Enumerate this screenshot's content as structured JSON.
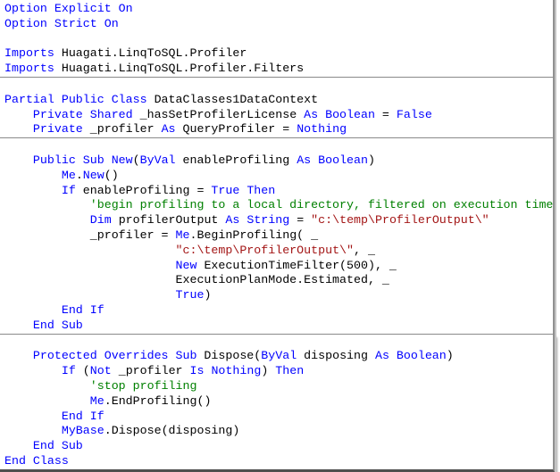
{
  "colors": {
    "keyword": "#0000ff",
    "text": "#000000",
    "comment": "#008000",
    "string": "#a31515",
    "background": "#ffffff",
    "separator_line": "#8a8a8a",
    "right_border": "#909090",
    "right_border_shadow": "#c4c4c4",
    "bottom_border": "#4f4f4f",
    "drop_shadow": "#a8a8a8"
  },
  "code": {
    "slices": [
      {
        "lines": [
          {
            "segments": [
              {
                "text": "Option Explicit On",
                "type": "keyword"
              }
            ]
          },
          {
            "segments": [
              {
                "text": "Option Strict On",
                "type": "keyword"
              }
            ]
          },
          {
            "segments": []
          },
          {
            "segments": [
              {
                "text": "Imports",
                "type": "keyword"
              },
              {
                "text": " Huagati.LinqToSQL.Profiler",
                "type": "text"
              }
            ]
          },
          {
            "segments": [
              {
                "text": "Imports",
                "type": "keyword"
              },
              {
                "text": " Huagati.LinqToSQL.Profiler.Filters",
                "type": "text"
              }
            ]
          }
        ]
      },
      {
        "lines": [
          {
            "segments": []
          },
          {
            "segments": [
              {
                "text": "Partial Public Class",
                "type": "keyword"
              },
              {
                "text": " DataClasses1DataContext",
                "type": "text"
              }
            ]
          },
          {
            "segments": [
              {
                "text": "    ",
                "type": "text"
              },
              {
                "text": "Private Shared",
                "type": "keyword"
              },
              {
                "text": " _hasSetProfilerLicense ",
                "type": "text"
              },
              {
                "text": "As Boolean",
                "type": "keyword"
              },
              {
                "text": " = ",
                "type": "text"
              },
              {
                "text": "False",
                "type": "keyword"
              }
            ]
          },
          {
            "segments": [
              {
                "text": "    ",
                "type": "text"
              },
              {
                "text": "Private",
                "type": "keyword"
              },
              {
                "text": " _profiler ",
                "type": "text"
              },
              {
                "text": "As",
                "type": "keyword"
              },
              {
                "text": " QueryProfiler = ",
                "type": "text"
              },
              {
                "text": "Nothing",
                "type": "keyword"
              }
            ]
          }
        ]
      },
      {
        "lines": [
          {
            "segments": []
          },
          {
            "segments": [
              {
                "text": "    ",
                "type": "text"
              },
              {
                "text": "Public Sub New",
                "type": "keyword"
              },
              {
                "text": "(",
                "type": "text"
              },
              {
                "text": "ByVal",
                "type": "keyword"
              },
              {
                "text": " enableProfiling ",
                "type": "text"
              },
              {
                "text": "As Boolean",
                "type": "keyword"
              },
              {
                "text": ")",
                "type": "text"
              }
            ]
          },
          {
            "segments": [
              {
                "text": "        ",
                "type": "text"
              },
              {
                "text": "Me",
                "type": "keyword"
              },
              {
                "text": ".",
                "type": "text"
              },
              {
                "text": "New",
                "type": "keyword"
              },
              {
                "text": "()",
                "type": "text"
              }
            ]
          },
          {
            "segments": [
              {
                "text": "        ",
                "type": "text"
              },
              {
                "text": "If",
                "type": "keyword"
              },
              {
                "text": " enableProfiling = ",
                "type": "text"
              },
              {
                "text": "True Then",
                "type": "keyword"
              }
            ]
          },
          {
            "segments": [
              {
                "text": "            'begin profiling to a local directory, filtered on execution time",
                "type": "comment"
              }
            ]
          },
          {
            "segments": [
              {
                "text": "            ",
                "type": "text"
              },
              {
                "text": "Dim",
                "type": "keyword"
              },
              {
                "text": " profilerOutput ",
                "type": "text"
              },
              {
                "text": "As String",
                "type": "keyword"
              },
              {
                "text": " = ",
                "type": "text"
              },
              {
                "text": "\"c:\\temp\\ProfilerOutput\\\"",
                "type": "string"
              }
            ]
          },
          {
            "segments": [
              {
                "text": "            _profiler = ",
                "type": "text"
              },
              {
                "text": "Me",
                "type": "keyword"
              },
              {
                "text": ".BeginProfiling( _",
                "type": "text"
              }
            ]
          },
          {
            "segments": [
              {
                "text": "                        ",
                "type": "text"
              },
              {
                "text": "\"c:\\temp\\ProfilerOutput\\\"",
                "type": "string"
              },
              {
                "text": ", _",
                "type": "text"
              }
            ]
          },
          {
            "segments": [
              {
                "text": "                        ",
                "type": "text"
              },
              {
                "text": "New",
                "type": "keyword"
              },
              {
                "text": " ExecutionTimeFilter(500), _",
                "type": "text"
              }
            ]
          },
          {
            "segments": [
              {
                "text": "                        ExecutionPlanMode.Estimated, _",
                "type": "text"
              }
            ]
          },
          {
            "segments": [
              {
                "text": "                        ",
                "type": "text"
              },
              {
                "text": "True",
                "type": "keyword"
              },
              {
                "text": ")",
                "type": "text"
              }
            ]
          },
          {
            "segments": [
              {
                "text": "        ",
                "type": "text"
              },
              {
                "text": "End If",
                "type": "keyword"
              }
            ]
          },
          {
            "segments": [
              {
                "text": "    ",
                "type": "text"
              },
              {
                "text": "End Sub",
                "type": "keyword"
              }
            ]
          }
        ]
      },
      {
        "lines": [
          {
            "segments": []
          },
          {
            "segments": [
              {
                "text": "    ",
                "type": "text"
              },
              {
                "text": "Protected Overrides Sub",
                "type": "keyword"
              },
              {
                "text": " Dispose(",
                "type": "text"
              },
              {
                "text": "ByVal",
                "type": "keyword"
              },
              {
                "text": " disposing ",
                "type": "text"
              },
              {
                "text": "As Boolean",
                "type": "keyword"
              },
              {
                "text": ")",
                "type": "text"
              }
            ]
          },
          {
            "segments": [
              {
                "text": "        ",
                "type": "text"
              },
              {
                "text": "If",
                "type": "keyword"
              },
              {
                "text": " (",
                "type": "text"
              },
              {
                "text": "Not",
                "type": "keyword"
              },
              {
                "text": " _profiler ",
                "type": "text"
              },
              {
                "text": "Is Nothing",
                "type": "keyword"
              },
              {
                "text": ") ",
                "type": "text"
              },
              {
                "text": "Then",
                "type": "keyword"
              }
            ]
          },
          {
            "segments": [
              {
                "text": "            'stop profiling",
                "type": "comment"
              }
            ]
          },
          {
            "segments": [
              {
                "text": "            ",
                "type": "text"
              },
              {
                "text": "Me",
                "type": "keyword"
              },
              {
                "text": ".EndProfiling()",
                "type": "text"
              }
            ]
          },
          {
            "segments": [
              {
                "text": "        ",
                "type": "text"
              },
              {
                "text": "End If",
                "type": "keyword"
              }
            ]
          },
          {
            "segments": [
              {
                "text": "        ",
                "type": "text"
              },
              {
                "text": "MyBase",
                "type": "keyword"
              },
              {
                "text": ".Dispose(disposing)",
                "type": "text"
              }
            ]
          },
          {
            "segments": [
              {
                "text": "    ",
                "type": "text"
              },
              {
                "text": "End Sub",
                "type": "keyword"
              }
            ]
          },
          {
            "segments": [
              {
                "text": "End Class",
                "type": "keyword"
              }
            ]
          }
        ]
      }
    ]
  }
}
